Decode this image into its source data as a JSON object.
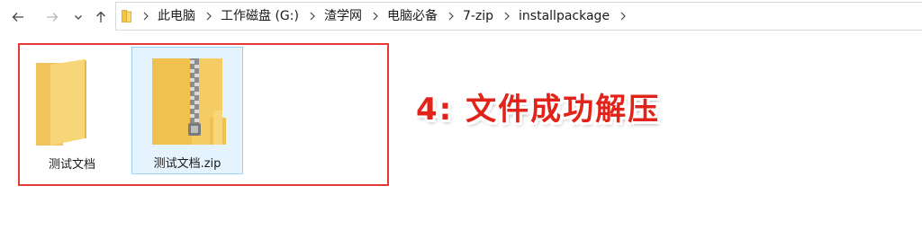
{
  "nav": {
    "back_icon": "arrow-left-icon",
    "forward_icon": "arrow-right-icon",
    "recent_icon": "chevron-down-icon",
    "up_icon": "arrow-up-icon"
  },
  "address": {
    "root_icon": "folder-icon",
    "crumbs": [
      "此电脑",
      "工作磁盘 (G:)",
      "渣学网",
      "电脑必备",
      "7-zip",
      "installpackage"
    ]
  },
  "files": [
    {
      "name": "测试文档",
      "type": "folder",
      "selected": false
    },
    {
      "name": "测试文档.zip",
      "type": "zip-folder",
      "selected": true
    }
  ],
  "annotation": {
    "caption": "4: 文件成功解压",
    "color": "#e2231a",
    "frame_color": "#e53935"
  }
}
